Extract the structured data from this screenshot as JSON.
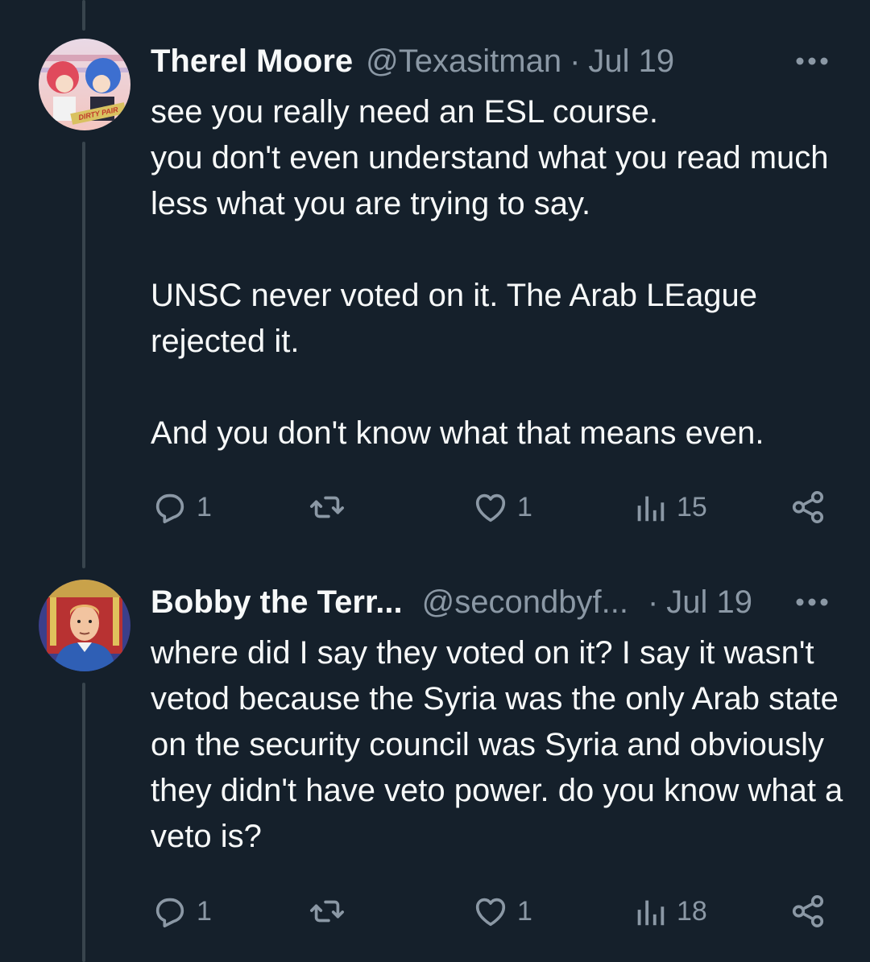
{
  "tweets": [
    {
      "name": "Therel Moore",
      "handle": "@Texasitman",
      "separator": "·",
      "date": "Jul 19",
      "avatar_text": "DIRTY PAIR",
      "paragraphs": [
        "see you really need an ESL course.\nyou don't even understand what you read much less what you are trying to say.",
        "UNSC never voted on it.  The Arab LEague rejected it.",
        "And you don't know what that means even."
      ],
      "stats": {
        "replies": "1",
        "retweets": "",
        "likes": "1",
        "views": "15"
      }
    },
    {
      "name": "Bobby the Terr...",
      "handle": "@secondbyf...",
      "separator": "·",
      "date": "Jul 19",
      "paragraphs": [
        "where did I say they voted on it? I say it wasn't vetod because the Syria was the only Arab state on the security council was Syria and obviously they didn't have veto power. do you know what a veto is?"
      ],
      "stats": {
        "replies": "1",
        "retweets": "",
        "likes": "1",
        "views": "18"
      }
    }
  ],
  "icons": {
    "reply": "reply-icon",
    "retweet": "retweet-icon",
    "like": "heart-icon",
    "views": "views-icon",
    "share": "share-icon",
    "more": "more-icon"
  },
  "colors": {
    "background": "#15202b",
    "text": "#f7f9f9",
    "secondary": "#8b98a5",
    "thread_line": "#38444d"
  }
}
